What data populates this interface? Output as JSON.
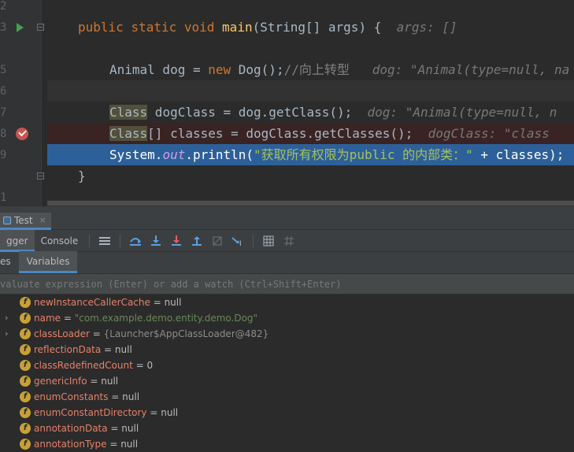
{
  "editor": {
    "line_numbers": [
      "2",
      "3",
      "5",
      "6",
      "7",
      "8",
      "9",
      "1"
    ],
    "line3": {
      "kw1": "public",
      "kw2": "static",
      "kw3": "void",
      "method": "main",
      "rest": "(String[] args) {",
      "hint": "args: []"
    },
    "line5": {
      "pre": "Animal dog = ",
      "kw": "new",
      "post": " Dog();",
      "comment": "//向上转型",
      "hint": "dog: \"Animal(type=null, na"
    },
    "line7": {
      "class_word": "Class",
      "rest": " dogClass = dog.getClass();",
      "hint": "dog: \"Animal(type=null, n"
    },
    "line8": {
      "class_word": "Class",
      "rest": "[] classes = dogClass.getClasses();",
      "hint": "dogClass: \"class"
    },
    "line9": {
      "pre": "System.",
      "field": "out",
      "mid": ".println(",
      "str": "\"获取所有权限为public 的内部类：\"",
      "post": " + classes);"
    },
    "line10": {
      "brace": "}"
    }
  },
  "tool_window": {
    "run_tab_label": "Test",
    "run_tab_close": "×",
    "tabs": [
      "gger",
      "Console"
    ],
    "sub_tabs": [
      "es",
      "Variables"
    ],
    "watch_placeholder": "valuate expression (Enter) or add a watch (Ctrl+Shift+Enter)",
    "icons": [
      "menu-icon",
      "step-over-icon",
      "step-into-icon",
      "force-step-into-icon",
      "step-out-icon",
      "drop-frame-icon",
      "run-to-cursor-icon",
      "evaluate-icon",
      "trace-icon"
    ]
  },
  "variables": [
    {
      "name": "newInstanceCallerCache",
      "eq": " = ",
      "value": "null",
      "kind": "null",
      "expandable": false
    },
    {
      "name": "name",
      "eq": " = ",
      "value": "\"com.example.demo.entity.demo.Dog\"",
      "kind": "str",
      "expandable": true
    },
    {
      "name": "classLoader",
      "eq": " = ",
      "value": "{Launcher$AppClassLoader@482}",
      "kind": "obj",
      "expandable": true
    },
    {
      "name": "reflectionData",
      "eq": " = ",
      "value": "null",
      "kind": "null",
      "expandable": false
    },
    {
      "name": "classRedefinedCount",
      "eq": " = ",
      "value": "0",
      "kind": "null",
      "expandable": false
    },
    {
      "name": "genericInfo",
      "eq": " = ",
      "value": "null",
      "kind": "null",
      "expandable": false
    },
    {
      "name": "enumConstants",
      "eq": " = ",
      "value": "null",
      "kind": "null",
      "expandable": false
    },
    {
      "name": "enumConstantDirectory",
      "eq": " = ",
      "value": "null",
      "kind": "null",
      "expandable": false
    },
    {
      "name": "annotationData",
      "eq": " = ",
      "value": "null",
      "kind": "null",
      "expandable": false
    },
    {
      "name": "annotationType",
      "eq": " = ",
      "value": "null",
      "kind": "null",
      "expandable": false
    }
  ],
  "field_icon_letter": "f",
  "expand_glyph": "›",
  "colors": {
    "keyword": "#cc7832",
    "method": "#ffc66d",
    "string": "#6a8759",
    "selected_line": "#2d6099",
    "breakpoint_line": "#3a2323",
    "breakpoint": "#c75450",
    "accent": "#4a88c7"
  }
}
